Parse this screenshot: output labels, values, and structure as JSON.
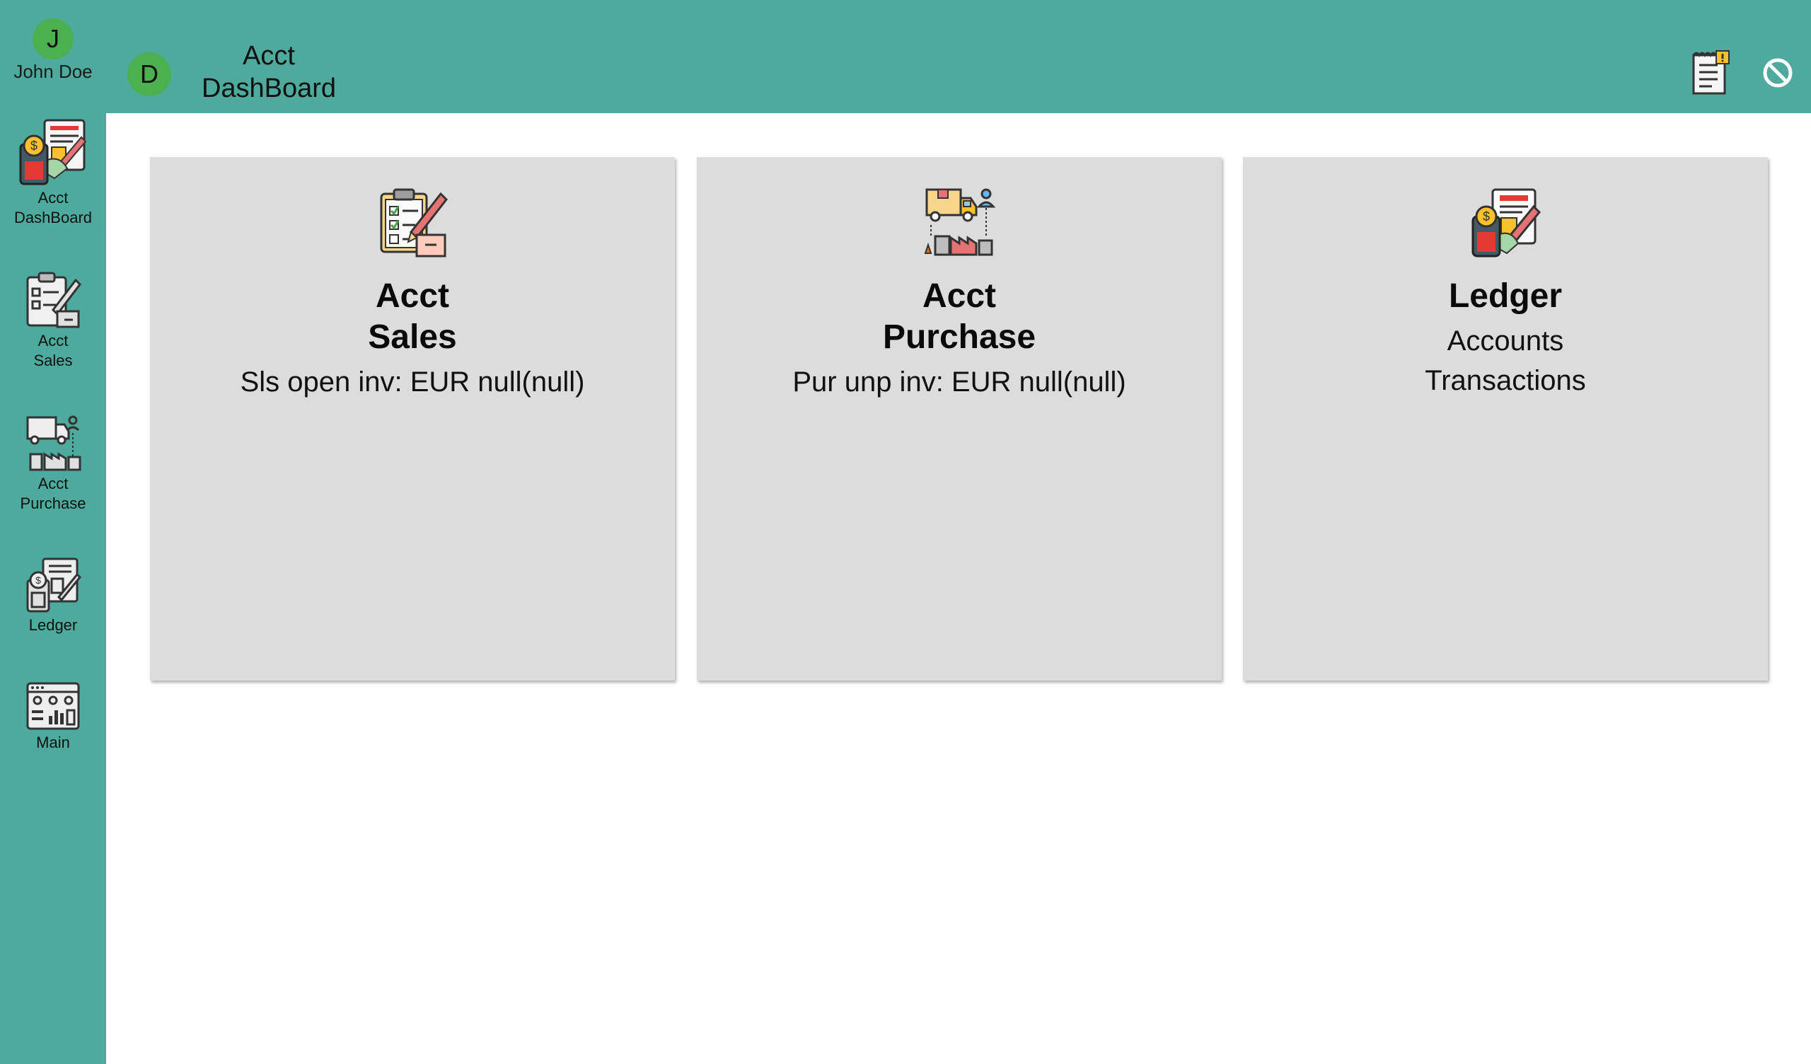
{
  "user": {
    "initial": "J",
    "name": "John Doe"
  },
  "sidebar": {
    "items": [
      {
        "label1": "Acct",
        "label2": "DashBoard",
        "icon": "accounting-dashboard-icon"
      },
      {
        "label1": "Acct",
        "label2": "Sales",
        "icon": "sales-checklist-icon"
      },
      {
        "label1": "Acct",
        "label2": "Purchase",
        "icon": "purchase-truck-factory-icon"
      },
      {
        "label1": "Ledger",
        "icon": "ledger-icon"
      },
      {
        "label1": "Main",
        "icon": "main-dashboard-icon"
      }
    ]
  },
  "header": {
    "badge": "D",
    "title_line1": "Acct",
    "title_line2": "DashBoard",
    "icons": [
      "notes-icon",
      "block-icon"
    ]
  },
  "cards": [
    {
      "title_line1": "Acct",
      "title_line2": "Sales",
      "subtitle": "Sls open inv: EUR null(null)",
      "icon": "sales-checklist-icon"
    },
    {
      "title_line1": "Acct",
      "title_line2": "Purchase",
      "subtitle": "Pur unp inv: EUR null(null)",
      "icon": "purchase-truck-factory-icon"
    },
    {
      "title_line1": "Ledger",
      "sub_line1": "Accounts",
      "sub_line2": "Transactions",
      "icon": "ledger-icon"
    }
  ],
  "colors": {
    "teal": "#4eaa9c",
    "avatar_green": "#4caf50",
    "card_bg": "#dcdcdc"
  }
}
